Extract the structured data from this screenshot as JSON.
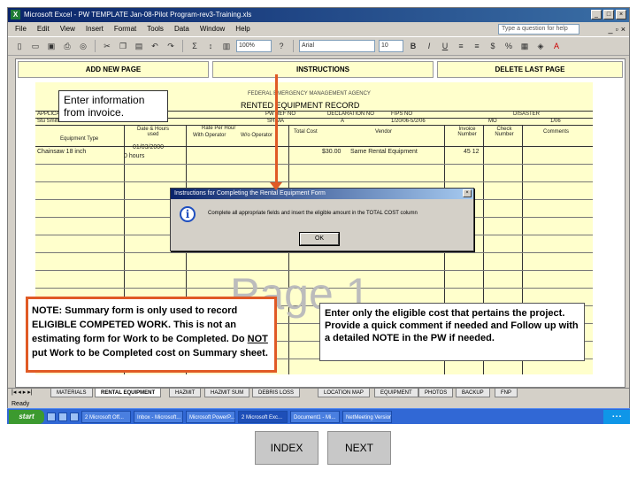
{
  "window": {
    "title": "Microsoft Excel - PW TEMPLATE Jan-08-Pilot Program-rev3-Training.xls"
  },
  "menu": [
    "File",
    "Edit",
    "View",
    "Insert",
    "Format",
    "Tools",
    "Data",
    "Window",
    "Help"
  ],
  "ask_placeholder": "Type a question for help",
  "toolbar": {
    "zoom": "100%",
    "font": "Arial",
    "size": "10"
  },
  "sheet_buttons": {
    "add": "ADD NEW PAGE",
    "instructions": "INSTRUCTIONS",
    "delete": "DELETE LAST PAGE"
  },
  "form": {
    "agency": "FEDERAL EMERGENCY MANAGEMENT AGENCY",
    "title": "RENTED EQUIPMENT RECORD",
    "row1": [
      "APPLICANT",
      "PW REF NO",
      "DECLARATION NO",
      "FIPS NO",
      "DISASTER"
    ],
    "row2": [
      "Stu Smith",
      "SHIMA",
      "A",
      "1/20/06-5/2/06",
      "MO",
      "1/06"
    ],
    "headers": [
      "Equipment Type",
      "Date & Hours used",
      "Rate Per Hour",
      "With Operator",
      "W/o Operator",
      "Total Cost",
      "Vendor",
      "Invoice Number",
      "Check Number",
      "Comments"
    ],
    "entry": {
      "type": "Chainsaw 18 inch",
      "date": "01/03/2000",
      "hours": "0 hours",
      "total": "$30.00",
      "vendor": "Same Rental Equipment",
      "invoice": "45 12"
    }
  },
  "watermark": "Page 1",
  "dialog": {
    "title": "Instructions for Completing the Rental Equipment Form",
    "message": "Complete all appropriate fields and insert the eligible amount in the TOTAL COST column",
    "ok": "OK"
  },
  "tabs": [
    "MATERIALS",
    "RENTAL EQUIPMENT",
    "HAZMIT",
    "HAZMIT SUM",
    "DEBRIS LOSS",
    "LOCATION MAP",
    "EQUIPMENT",
    "PHOTOS",
    "BACKUP",
    "FNP"
  ],
  "status": "Ready",
  "taskbar": {
    "start": "start",
    "tasks": [
      "2 Microsoft Off...",
      "Inbox - Microsoft...",
      "Microsoft PowerP...",
      "2 Microsoft Exc...",
      "Document1 - Mi...",
      "NetMeeting Version..."
    ]
  },
  "callouts": {
    "top": "Enter information from invoice.",
    "note_parts": [
      "NOTE: Summary form is only used to record ELIGIBLE COMPETED WORK.  This is not an estimating form for Work to be Completed. Do ",
      "NOT",
      " put Work to be Completed cost on Summary sheet."
    ],
    "right": "Enter only the eligible cost that pertains the project.  Provide a quick comment if needed and Follow up with a detailed NOTE in the PW if needed."
  },
  "nav": {
    "index": "INDEX",
    "next": "NEXT"
  },
  "colors": {
    "callout_border": "#e05a25",
    "form_bg": "#ffffcc",
    "titlebar": "#0a246a"
  }
}
